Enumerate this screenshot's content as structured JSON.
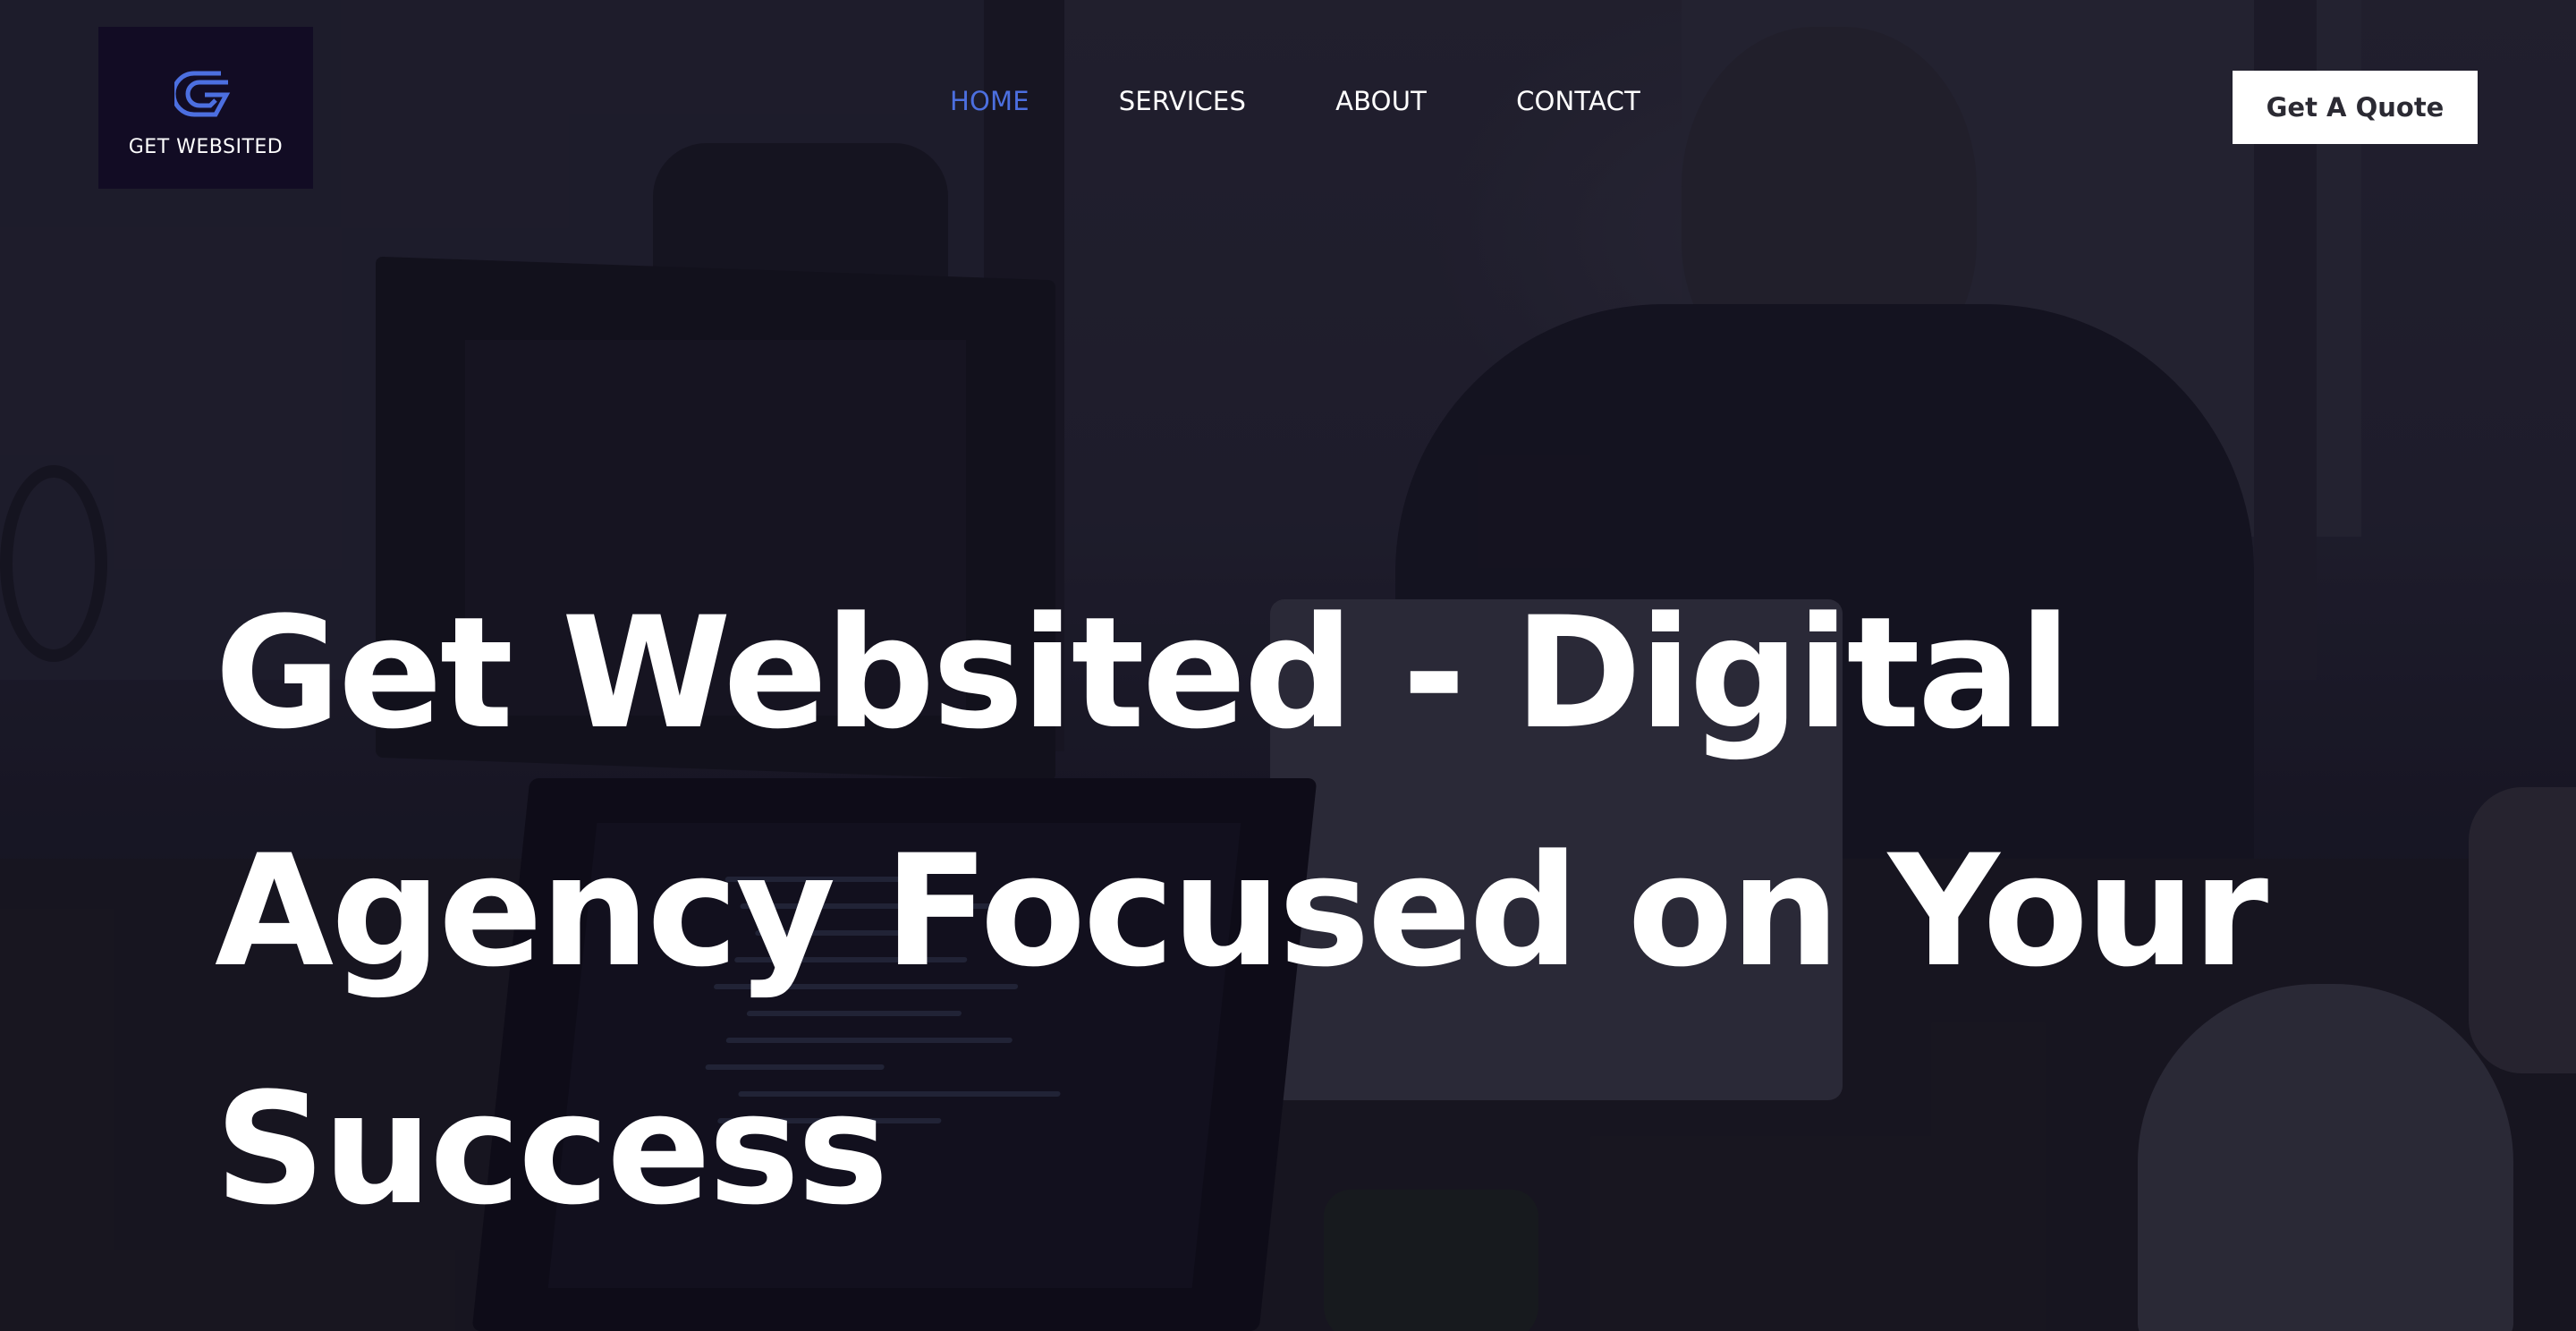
{
  "brand": {
    "logo_text": "GET WEBSITED",
    "logo_icon": "stylized-g-logo-icon",
    "logo_color": "#4c6fe0",
    "logo_bg": "#120c24"
  },
  "nav": {
    "items": [
      {
        "label": "HOME",
        "active": true
      },
      {
        "label": "SERVICES",
        "active": false
      },
      {
        "label": "ABOUT",
        "active": false
      },
      {
        "label": "CONTACT",
        "active": false
      }
    ],
    "active_color": "#4c6fe0"
  },
  "header": {
    "cta_label": "Get A Quote"
  },
  "hero": {
    "title_lines": [
      "Get Websited - Digital",
      "Agency Focused on Your",
      "Success"
    ],
    "background": "dimmed-office-photo"
  }
}
